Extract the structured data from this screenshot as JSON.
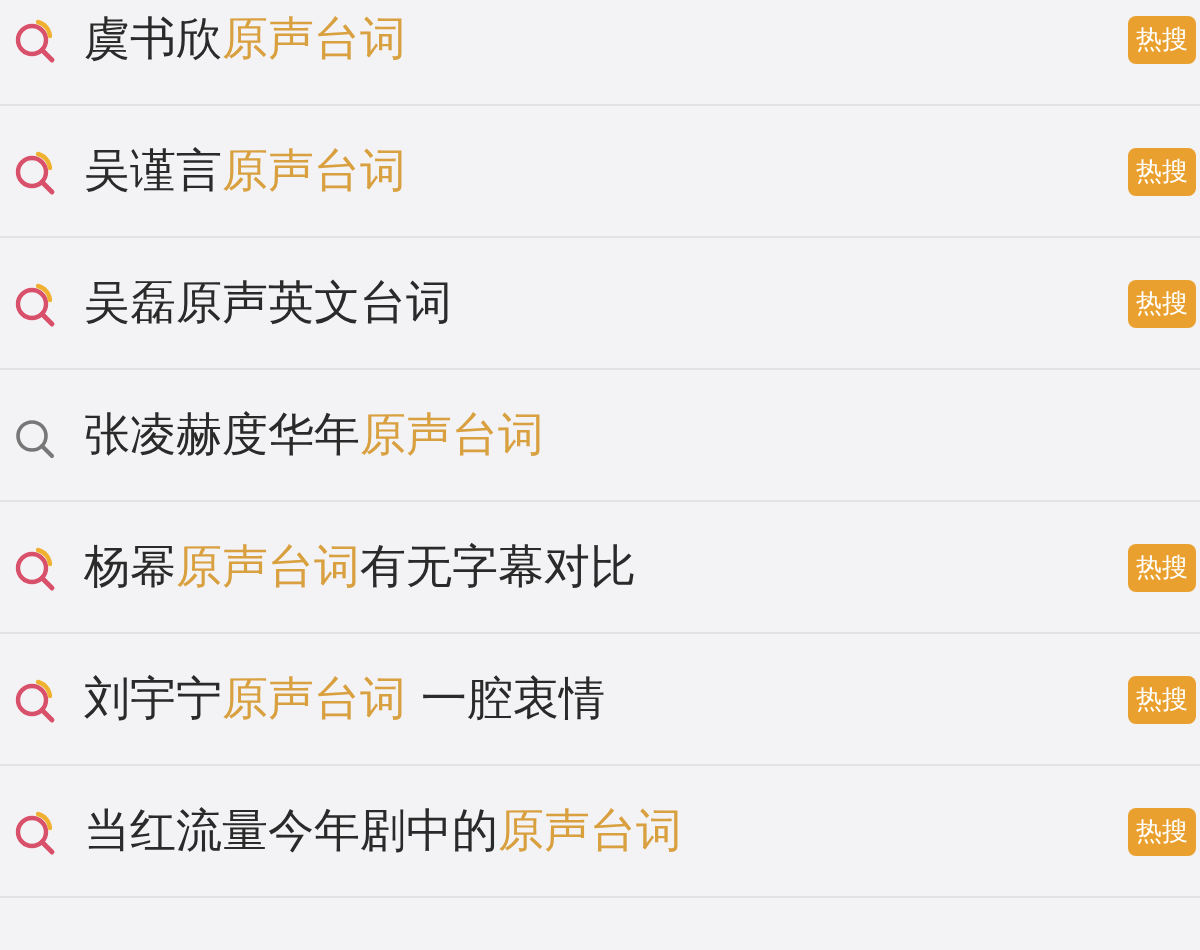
{
  "suggestions": [
    {
      "hot": true,
      "badge": "热搜",
      "parts": [
        {
          "text": "虞书欣",
          "highlight": false
        },
        {
          "text": "原声台词",
          "highlight": true
        }
      ]
    },
    {
      "hot": true,
      "badge": "热搜",
      "parts": [
        {
          "text": "吴谨言",
          "highlight": false
        },
        {
          "text": "原声台词",
          "highlight": true
        }
      ]
    },
    {
      "hot": true,
      "badge": "热搜",
      "parts": [
        {
          "text": "吴磊原声英文台词",
          "highlight": false
        }
      ]
    },
    {
      "hot": false,
      "parts": [
        {
          "text": "张凌赫度华年",
          "highlight": false
        },
        {
          "text": "原声台词",
          "highlight": true
        }
      ]
    },
    {
      "hot": true,
      "badge": "热搜",
      "parts": [
        {
          "text": "杨幂",
          "highlight": false
        },
        {
          "text": "原声台词",
          "highlight": true
        },
        {
          "text": "有无字幕对比",
          "highlight": false
        }
      ]
    },
    {
      "hot": true,
      "badge": "热搜",
      "parts": [
        {
          "text": "刘宇宁",
          "highlight": false
        },
        {
          "text": "原声台词",
          "highlight": true
        },
        {
          "text": " 一腔衷情",
          "highlight": false
        }
      ]
    },
    {
      "hot": true,
      "badge": "热搜",
      "parts": [
        {
          "text": "当红流量今年剧中的",
          "highlight": false
        },
        {
          "text": "原声台词",
          "highlight": true
        }
      ]
    }
  ]
}
